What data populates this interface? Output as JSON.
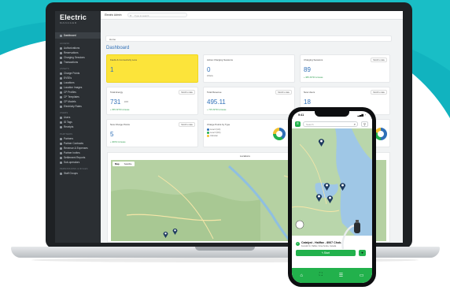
{
  "app": {
    "brand": "Electric",
    "brand_sub": "MANAGER",
    "topbar_title": "Electric Admin",
    "search_placeholder": "Type to search"
  },
  "breadcrumb": "Home",
  "page_title": "Dashboard",
  "sidebar": {
    "active": "Dashboard",
    "sections": [
      {
        "title": "ACCESS",
        "items": [
          "Authorizations",
          "Reservations",
          "Charging Sessions",
          "Transactions"
        ]
      },
      {
        "title": "ASSETS",
        "items": [
          "Charge Points",
          "EVSEs",
          "Locations",
          "Location Images",
          "CP Profiles",
          "CP Templates",
          "CP Models",
          "Electricity Rates"
        ]
      },
      {
        "title": "USERS",
        "items": [
          "Users",
          "ID Tags",
          "Receipts"
        ]
      },
      {
        "title": "PARTNERS",
        "items": [
          "Partners",
          "Partner Contracts",
          "Revenue & Expenses",
          "Partner Invites",
          "Settlement Reports",
          "Sub-operators"
        ]
      },
      {
        "title": "PERMISSIONS & ROLES",
        "items": [
          "Staff Groups"
        ]
      }
    ]
  },
  "cards": {
    "faults": {
      "label": "Faults & Connectivity Loss",
      "value": "1"
    },
    "active_sessions": {
      "label": "Active Charging Sessions",
      "value": "0",
      "sub": "kWatts"
    },
    "charging_sessions": {
      "label": "Charging Sessions",
      "value": "89",
      "pill": "Month to date",
      "trend": "+ 38% MTD Increase"
    },
    "total_energy": {
      "label": "Total Energy",
      "value": "731",
      "unit": "kWh",
      "pill": "Month to date",
      "trend": "+ 35% MTD Increase"
    },
    "total_revenue": {
      "label": "Total Revenue",
      "value": "495.11",
      "pill": "Month to date",
      "trend": "+ 72% MTD Increase"
    },
    "new_users": {
      "label": "New Users",
      "value": "18",
      "pill": "Month to date",
      "trend": "+ 10% MTD Increase"
    },
    "new_charge_points": {
      "label": "New Charge Points",
      "value": "5",
      "pill": "Month to date",
      "trend": "+ 400% Increase"
    },
    "charge_points_by_type": {
      "label": "Charge Points by Type",
      "legend": [
        "Level 2 (AC)",
        "Level 3 (DC)",
        "Unknown"
      ]
    }
  },
  "map": {
    "title": "Locations",
    "tab_map": "Map",
    "tab_satellite": "Satellite"
  },
  "phone": {
    "time": "9:41",
    "status": "▂▄▆ ◔",
    "search_placeholder": "Search",
    "location_name": "Catalyst - Halifax - 8067 Chob...",
    "location_addr": "Fenwick St, Halifax, Nova Scotia, Canada",
    "start_label": "Start"
  },
  "colors": {
    "brand_blue": "#2f6fb7",
    "accent_green": "#22b14c",
    "alert_yellow": "#fce43a",
    "sidebar": "#2b2f33"
  }
}
